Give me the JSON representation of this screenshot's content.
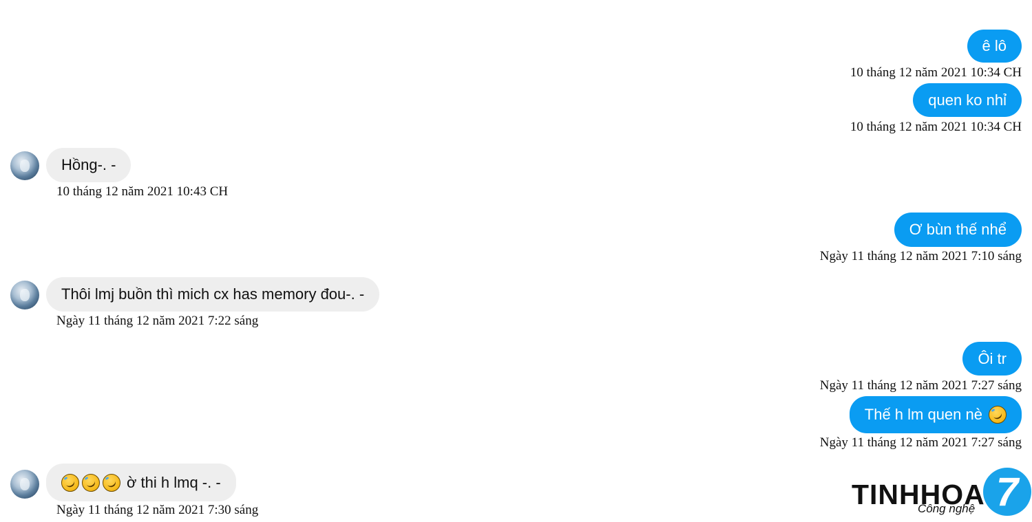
{
  "messages": [
    {
      "dir": "out",
      "text": "ê lô",
      "time": "10 tháng 12 năm 2021 10:34 CH"
    },
    {
      "dir": "out",
      "text": "quen ko nhỉ",
      "time": "10 tháng 12 năm 2021 10:34 CH"
    },
    {
      "dir": "in",
      "text": "Hồng-. -",
      "time": "10 tháng 12 năm 2021 10:43 CH"
    },
    {
      "dir": "out",
      "text": "Ơ bùn thế nhể",
      "time": "Ngày 11 tháng 12 năm 2021 7:10 sáng"
    },
    {
      "dir": "in",
      "text": "Thôi lmj buồn thì mich cx has memory đou-. -",
      "time": "Ngày 11 tháng 12 năm 2021 7:22 sáng"
    },
    {
      "dir": "out",
      "text": "Ôi tr",
      "time": "Ngày 11 tháng 12 năm 2021 7:27 sáng"
    },
    {
      "dir": "out",
      "text": "Thế h lm quen nè",
      "emoji_after": "rolling-on-floor-laughing",
      "time": "Ngày 11 tháng 12 năm 2021 7:27 sáng"
    },
    {
      "dir": "in",
      "emoji_before": [
        "rolling-on-floor-laughing",
        "rolling-on-floor-laughing",
        "rolling-on-floor-laughing"
      ],
      "text": "ờ thi h lmq -. -",
      "time": "Ngày 11 tháng 12 năm 2021 7:30 sáng"
    }
  ],
  "colors": {
    "outgoing_bubble": "#0a9cf2",
    "incoming_bubble": "#eeeeee"
  },
  "watermark": {
    "brand": "TINHHOA",
    "tagline": "Công nghệ",
    "badge": "7"
  }
}
